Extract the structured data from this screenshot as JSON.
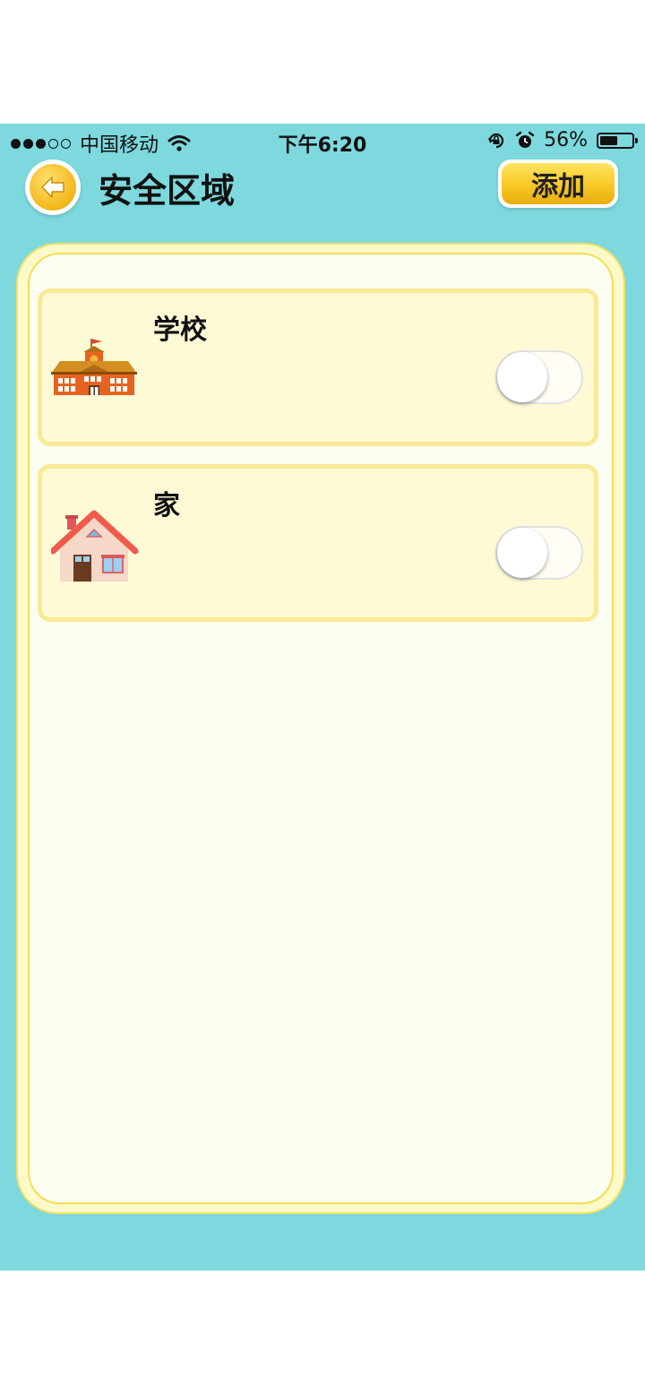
{
  "status_bar": {
    "carrier": "中国移动",
    "time": "下午6:20",
    "battery_percent": "56%",
    "battery_level": 0.56,
    "icons": [
      "signal-dots-icon",
      "wifi-icon",
      "orientation-lock-icon",
      "alarm-icon",
      "battery-icon"
    ]
  },
  "header": {
    "title": "安全区域",
    "add_label": "添加",
    "back_icon": "back-arrow-icon"
  },
  "zones": [
    {
      "name": "学校",
      "icon": "school-icon",
      "enabled": false
    },
    {
      "name": "家",
      "icon": "house-icon",
      "enabled": false
    }
  ],
  "colors": {
    "background": "#7dd9de",
    "accent": "#f7c823",
    "card": "#fffad6",
    "card_border": "#f9e995"
  }
}
